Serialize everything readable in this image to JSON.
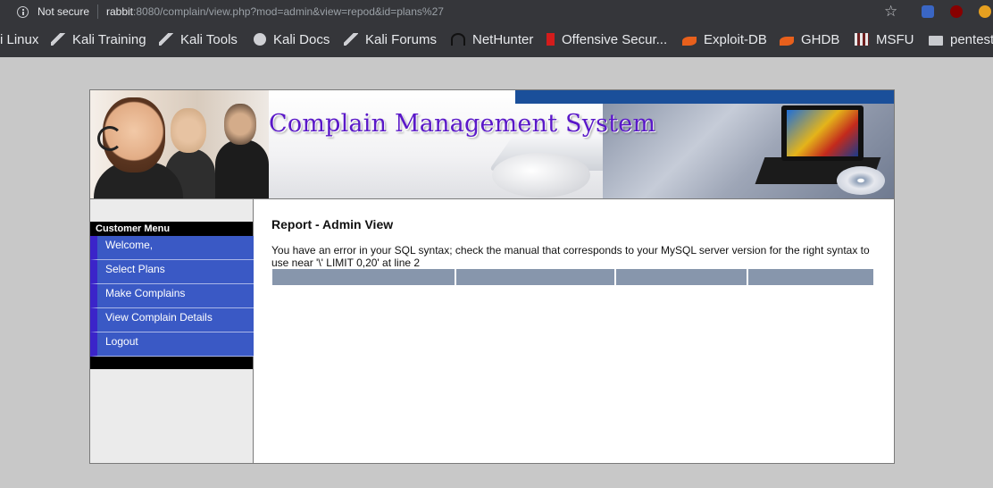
{
  "browser": {
    "security_label": "Not secure",
    "url_host": "rabbit",
    "url_rest": ":8080/complain/view.php?mod=admin&view=repod&id=plans%27",
    "bookmarks": [
      {
        "label": "i Linux",
        "icon": "kali-dragon-icon"
      },
      {
        "label": "Kali Training",
        "icon": "kali-dragon-icon"
      },
      {
        "label": "Kali Tools",
        "icon": "kali-dragon-icon"
      },
      {
        "label": "Kali Docs",
        "icon": "globe-icon"
      },
      {
        "label": "Kali Forums",
        "icon": "kali-dragon-icon"
      },
      {
        "label": "NetHunter",
        "icon": "nethunter-icon"
      },
      {
        "label": "Offensive Secur...",
        "icon": "offsec-icon"
      },
      {
        "label": "Exploit-DB",
        "icon": "exploit-db-icon"
      },
      {
        "label": "GHDB",
        "icon": "exploit-db-icon"
      },
      {
        "label": "MSFU",
        "icon": "msfu-icon"
      },
      {
        "label": "pentest",
        "icon": "folder-icon"
      }
    ]
  },
  "banner": {
    "title": "Complain Management System",
    "accent_color": "#1a4f9a",
    "title_color": "#5a18c8"
  },
  "sidebar": {
    "header": "Customer Menu",
    "items": [
      {
        "label": "Welcome,"
      },
      {
        "label": "Select Plans"
      },
      {
        "label": "Make Complains"
      },
      {
        "label": "View Complain Details"
      },
      {
        "label": "Logout"
      }
    ]
  },
  "content": {
    "heading": "Report - Admin View",
    "error_message": "You have an error in your SQL syntax; check the manual that corresponds to your MySQL server version for the right syntax to use near '\\' LIMIT 0,20' at line 2",
    "table_header_color": "#8796ac",
    "table_columns": [
      "",
      "",
      "",
      ""
    ]
  }
}
